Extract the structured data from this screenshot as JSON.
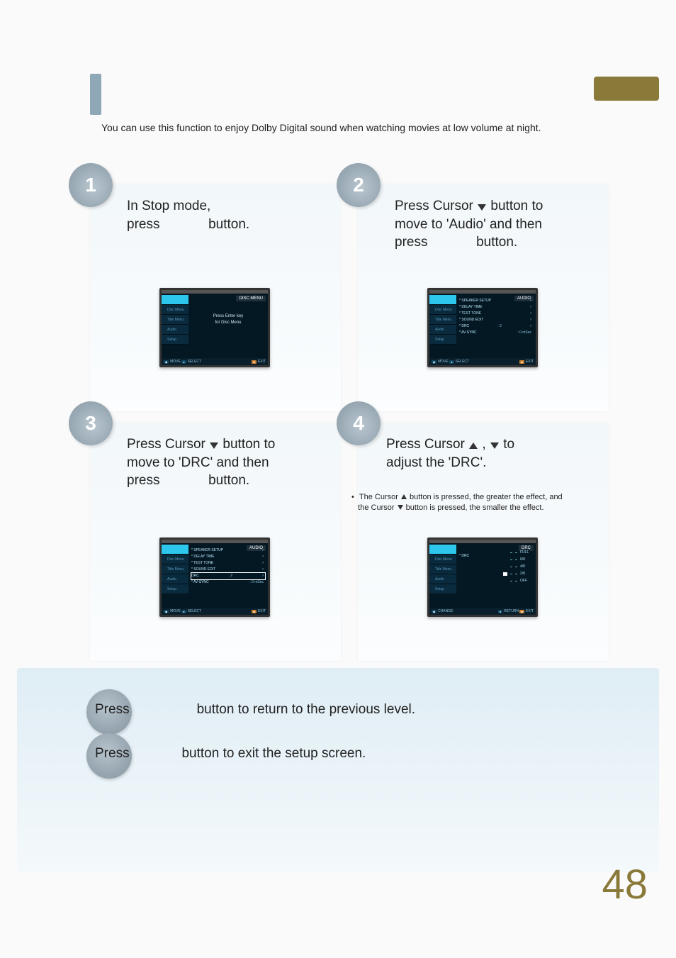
{
  "intro_text": "You can use this function to enjoy Dolby Digital sound when watching movies at low volume at night.",
  "panels": {
    "p1": {
      "num": "1",
      "line1": "In Stop mode,",
      "line2a": "press",
      "line2b": "button."
    },
    "p2": {
      "num": "2",
      "line1a": "Press Cursor",
      "line1b": "button to",
      "line2": "move to 'Audio' and then",
      "line3a": "press",
      "line3b": "button."
    },
    "p3": {
      "num": "3",
      "line1a": "Press Cursor",
      "line1b": "button to",
      "line2": "move to 'DRC' and then",
      "line3a": "press",
      "line3b": "button."
    },
    "p4": {
      "num": "4",
      "line1a": "Press Cursor",
      "line1b": ",",
      "line1c": "to",
      "line2": "adjust the 'DRC'."
    }
  },
  "sidetabs": [
    "",
    "Disc Menu",
    "Title Menu",
    "Audio",
    "Setup"
  ],
  "screen1": {
    "header": "DISC MENU",
    "center1": "Press Enter key",
    "center2": "for Disc Menu"
  },
  "screen2": {
    "header": "AUDIO",
    "items": [
      {
        "label": "* SPEAKER SETUP",
        "val": "",
        "arrow": "›"
      },
      {
        "label": "* DELAY TIME",
        "val": "",
        "arrow": "›"
      },
      {
        "label": "* TEST TONE",
        "val": "",
        "arrow": "›"
      },
      {
        "label": "* SOUND EDIT",
        "val": "",
        "arrow": "›"
      },
      {
        "label": "* DRC",
        "val": ": 2",
        "arrow": "›"
      },
      {
        "label": "* AV-SYNC",
        "val": ": 0 mSec",
        "arrow": ""
      }
    ]
  },
  "screen3": {
    "header": "AUDIO",
    "items": [
      {
        "label": "* SPEAKER SETUP",
        "val": "",
        "arrow": "›",
        "boxed": false
      },
      {
        "label": "* DELAY TIME",
        "val": "",
        "arrow": "›",
        "boxed": false
      },
      {
        "label": "* TEST TONE",
        "val": "",
        "arrow": "›",
        "boxed": false
      },
      {
        "label": "* SOUND EDIT",
        "val": "",
        "arrow": "›",
        "boxed": false
      },
      {
        "label": "DRC",
        "val": ": 2",
        "arrow": "›",
        "boxed": true
      },
      {
        "label": "* AV-SYNC",
        "val": ": 0 mSec",
        "arrow": "",
        "boxed": false
      }
    ]
  },
  "screen4": {
    "header": "DRC",
    "item": "* DRC",
    "levels": [
      "FULL",
      "6/8",
      "4/8",
      "2/8",
      "OFF"
    ],
    "marker_index": 3
  },
  "foot": {
    "move": "MOVE",
    "select": "SELECT",
    "exit": "EXIT",
    "change": "CHANGE",
    "ret": "RETURN"
  },
  "note": {
    "t1": "The Cursor",
    "t2": "button is pressed, the greater the effect, and",
    "t3": "the Cursor",
    "t4": "button is pressed, the smaller the effect."
  },
  "bottom": {
    "press": "Press",
    "ret_text": "button to return to the previous level.",
    "exit_text": "button to exit the setup screen."
  },
  "page_number": "48"
}
